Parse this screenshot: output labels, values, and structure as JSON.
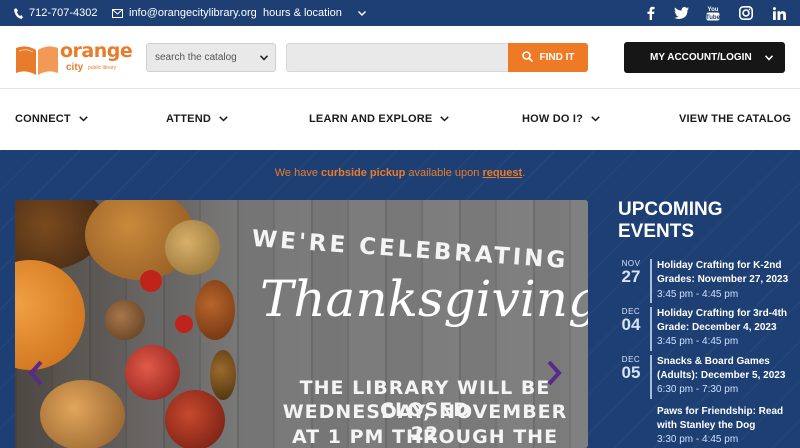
{
  "topbar": {
    "phone": "712-707-4302",
    "email": "info@orangecitylibrary.org",
    "hours_link": "hours & location",
    "social": [
      "facebook-icon",
      "twitter-icon",
      "youtube-icon",
      "instagram-icon",
      "linkedin-icon"
    ],
    "youtube_text": "You\nTube"
  },
  "logo": {
    "name": "orange",
    "city": "city",
    "tagline": "public library"
  },
  "search": {
    "scope_value": "search the catalog",
    "query_placeholder": "",
    "submit_label": "FIND IT"
  },
  "account": {
    "label": "MY ACCOUNT/LOGIN"
  },
  "nav": {
    "items": [
      "CONNECT",
      "ATTEND",
      "LEARN AND EXPLORE",
      "HOW DO I?",
      "VIEW THE CATALOG"
    ]
  },
  "notice": {
    "prefix": "We have ",
    "bold": "curbside pickup",
    "middle": " available upon ",
    "link": "request",
    "suffix": "."
  },
  "banner": {
    "heading": "WE'RE CELEBRATING",
    "script": "Thanksgiving",
    "line1": "THE LIBRARY WILL BE CLOSED",
    "line2": "WEDNESDAY, NOVEMBER 22",
    "line3": "AT 1 PM THROUGH THE"
  },
  "events": {
    "title": "UPCOMING EVENTS",
    "items": [
      {
        "month": "NOV",
        "day": "27",
        "title": "Holiday Crafting for K-2nd Grades: November 27, 2023",
        "time": "3:45 pm - 4:45 pm"
      },
      {
        "month": "DEC",
        "day": "04",
        "title": "Holiday Crafting for 3rd-4th Grade: December 4, 2023",
        "time": "3:45 pm - 4:45 pm"
      },
      {
        "month": "DEC",
        "day": "05",
        "title": "Snacks & Board Games (Adults): December 5, 2023",
        "time": "6:30 pm - 7:30 pm"
      },
      {
        "month": "",
        "day": "",
        "title": "Paws for Friendship: Read with Stanley the Dog",
        "time": "3:30 pm - 4:45 pm"
      }
    ]
  },
  "colors": {
    "navy": "#1d3f74",
    "orange": "#ef7a26",
    "black": "#161616"
  }
}
